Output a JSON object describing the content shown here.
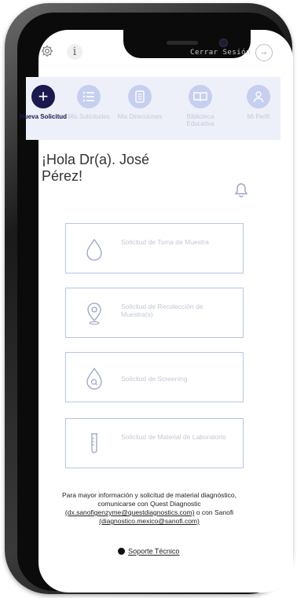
{
  "header": {
    "settings_icon": "gear-icon",
    "info_label": "i",
    "logout_label": "Cerrar Sesión"
  },
  "nav": {
    "items": [
      {
        "label": "Nueva Solicitud",
        "icon": "plus-icon",
        "active": true
      },
      {
        "label": "Mis Solicitudes",
        "icon": "list-icon",
        "active": false
      },
      {
        "label": "Mis Direcciones",
        "icon": "document-icon",
        "active": false
      },
      {
        "label": "Biblioteca Educativa",
        "icon": "book-icon",
        "active": false
      },
      {
        "label": "Mi Perfil",
        "icon": "user-icon",
        "active": false
      }
    ]
  },
  "main": {
    "greeting": "¡Hola Dr(a). José Pérez!",
    "cards": [
      {
        "label": "Solicitud de Toma de Muestra",
        "icon": "drop-icon"
      },
      {
        "label": "Solicitud de Recolección de Muestra(s)",
        "icon": "location-pin-icon"
      },
      {
        "label": "Solicitud de Screening",
        "icon": "drop-search-icon"
      },
      {
        "label": "Solicitud de Material de Laboratorio",
        "icon": "test-tube-icon"
      }
    ]
  },
  "footer": {
    "line1": "Para mayor información y solicitud de material diagnóstico,",
    "line2": "comunicarse con Quest Diagnostic",
    "email1": "(dx.sanofigenzyme@questdiagnostics.com)",
    "connector": " o con Sanofi",
    "email2": "(diagnostico.mexico@sanofi.com)",
    "support_label": "Soporte Técnico"
  },
  "colors": {
    "brand_dark": "#1a1a4e",
    "nav_bg": "#edf0f8",
    "nav_inactive": "#c7cff0",
    "card_border": "#b7c4e8"
  }
}
